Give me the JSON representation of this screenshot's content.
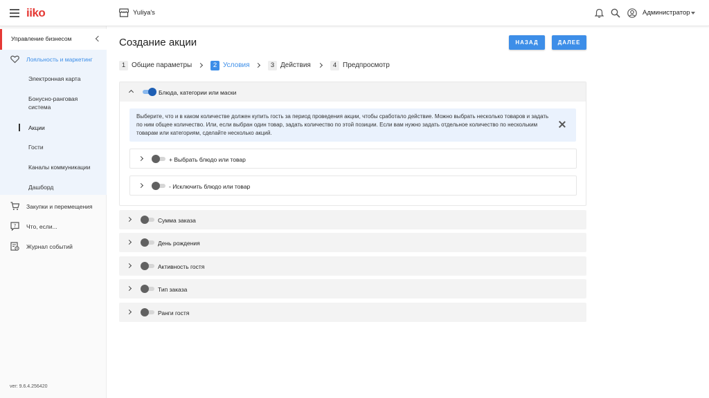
{
  "header": {
    "logo": "iiko",
    "store_name": "Yuliya's",
    "user_name": "Администратор",
    "icons": [
      "menu-icon",
      "store-icon",
      "bell-icon",
      "search-icon",
      "account-icon",
      "caret-down-icon"
    ]
  },
  "sidebar": {
    "section_title": "Управление бизнесом",
    "group_title": "Лояльность и маркетинг",
    "sub_items": [
      {
        "label": "Электронная карта"
      },
      {
        "label": "Бонусно-ранговая система"
      },
      {
        "label": "Акции",
        "active": true
      },
      {
        "label": "Гости"
      },
      {
        "label": "Каналы коммуникации"
      },
      {
        "label": "Дашборд"
      }
    ],
    "items": [
      {
        "label": "Закупки и перемещения",
        "icon": "cart-icon"
      },
      {
        "label": "Что, если...",
        "icon": "question-icon"
      },
      {
        "label": "Журнал событий",
        "icon": "journal-icon"
      }
    ],
    "version": "ver: 9.6.4.256420"
  },
  "main": {
    "title": "Создание акции",
    "back_label": "НАЗАД",
    "next_label": "ДАЛЕЕ",
    "steps": [
      {
        "num": "1",
        "label": "Общие параметры"
      },
      {
        "num": "2",
        "label": "Условия",
        "current": true
      },
      {
        "num": "3",
        "label": "Действия"
      },
      {
        "num": "4",
        "label": "Предпросмотр"
      }
    ],
    "open_section": {
      "title": "Блюда, категории или маски",
      "enabled": true,
      "info": "Выберите, что и в каком количестве должен купить гость за период проведения акции, чтобы сработало действие. Можно выбрать несколько товаров и задать по ним общее количество. Или, если выбран один товар, задать количество по этой позиции. Если вам нужно задать отдельное количество по нескольким товарам или категориям, сделайте несколько акций.",
      "sub_items": [
        {
          "label": "+ Выбрать блюдо или товар",
          "enabled": false
        },
        {
          "label": "- Исключить блюдо или товар",
          "enabled": false
        }
      ]
    },
    "sections": [
      {
        "title": "Сумма заказа",
        "enabled": false
      },
      {
        "title": "День рождения",
        "enabled": false
      },
      {
        "title": "Активность гостя",
        "enabled": false
      },
      {
        "title": "Тип заказа",
        "enabled": false
      },
      {
        "title": "Ранги гостя",
        "enabled": false
      }
    ]
  },
  "colors": {
    "accent": "#3d8ee8",
    "brand": "#e53935",
    "toggle_on": "#1e5fb4",
    "info_bg": "#eaf2fd",
    "sidebar_group_bg": "#eef4fc"
  }
}
